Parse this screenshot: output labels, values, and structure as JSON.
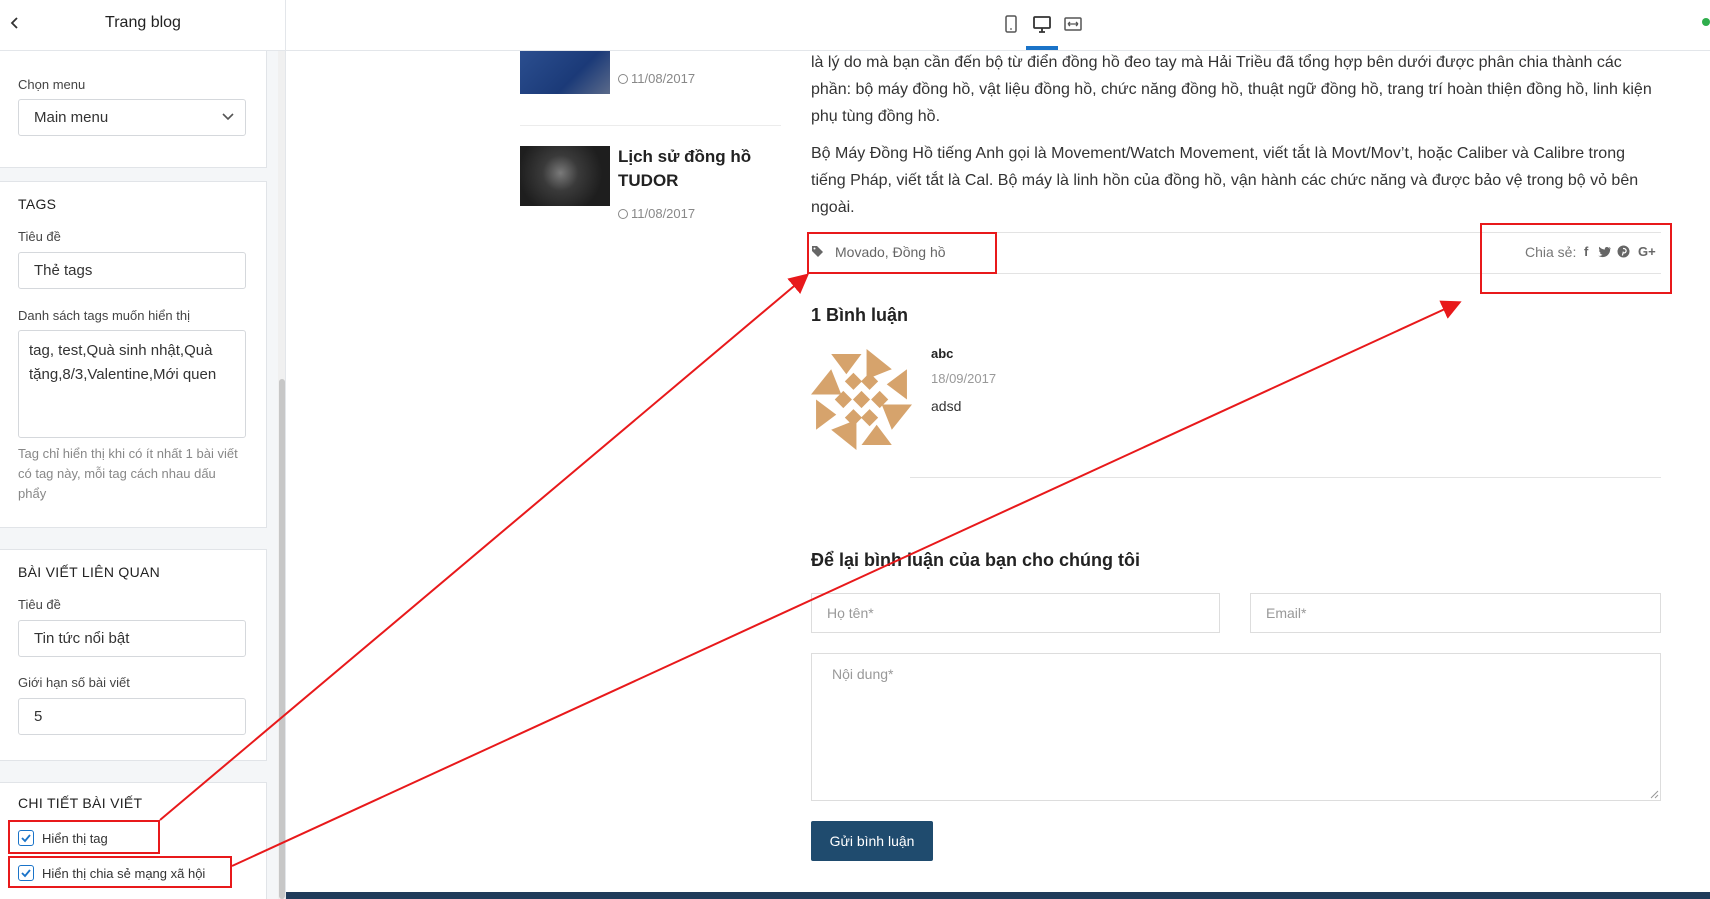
{
  "editor": {
    "title": "Trang blog",
    "menu_section": {
      "label": "Chọn menu",
      "value": "Main menu"
    },
    "tags_section": {
      "heading": "TAGS",
      "title_label": "Tiêu đề",
      "title_value": "Thẻ tags",
      "list_label": "Danh sách tags muốn hiển thị",
      "list_value": "tag, test,Quà sinh nhật,Quà tặng,8/3,Valentine,Mới quen",
      "hint": "Tag chỉ hiển thị khi có ít nhất 1 bài viết có tag này, mỗi tag cách nhau dấu phẩy"
    },
    "related_section": {
      "heading": "BÀI VIẾT LIÊN QUAN",
      "title_label": "Tiêu đề",
      "title_value": "Tin tức nổi bật",
      "limit_label": "Giới hạn số bài viết",
      "limit_value": "5"
    },
    "detail_section": {
      "heading": "CHI TIẾT BÀI VIẾT",
      "show_tag": {
        "label": "Hiển thị tag",
        "checked": true
      },
      "show_share": {
        "label": "Hiển thị chia sẻ mạng xã hội",
        "checked": true
      }
    }
  },
  "preview": {
    "device_icons": [
      "mobile-icon",
      "desktop-icon",
      "fullwidth-icon"
    ],
    "sidebar_posts": [
      {
        "title": "",
        "date": "11/08/2017"
      },
      {
        "title": "Lịch sử đồng hồ TUDOR",
        "date": "11/08/2017"
      }
    ],
    "article": {
      "para1": "là lý do mà bạn cần đến bộ từ điển đồng hồ đeo tay mà Hải Triều đã tổng hợp bên dưới được phân chia thành các phần: bộ máy đồng hồ, vật liệu đồng hồ, chức năng đồng hồ, thuật ngữ đồng hồ, trang trí hoàn thiện đồng hồ, linh kiện phụ tùng đồng hồ.",
      "para2": "Bộ Máy Đồng Hồ tiếng Anh gọi là Movement/Watch Movement, viết tắt là Movt/Mov’t, hoặc Caliber và Calibre trong tiếng Pháp, viết tắt là Cal. Bộ máy là linh hồn của đồng hồ, vận hành các chức năng và được bảo vệ trong bộ vỏ bên ngoài.",
      "tags": "Movado, Đồng hồ",
      "share_label": "Chia sẻ:",
      "share_icons": [
        "facebook-icon",
        "twitter-icon",
        "pinterest-icon",
        "google-plus-icon"
      ]
    },
    "comments": {
      "heading": "1 Bình luận",
      "items": [
        {
          "author": "abc",
          "date": "18/09/2017",
          "text": "adsd"
        }
      ]
    },
    "form": {
      "heading": "Để lại bình luận của bạn cho chúng tôi",
      "name_placeholder": "Họ tên*",
      "email_placeholder": "Email*",
      "content_placeholder": "Nội dung*",
      "submit": "Gửi bình luận"
    }
  },
  "colors": {
    "annotation": "#e8191b",
    "accent": "#1a73c8",
    "button": "#1f4b6e"
  }
}
